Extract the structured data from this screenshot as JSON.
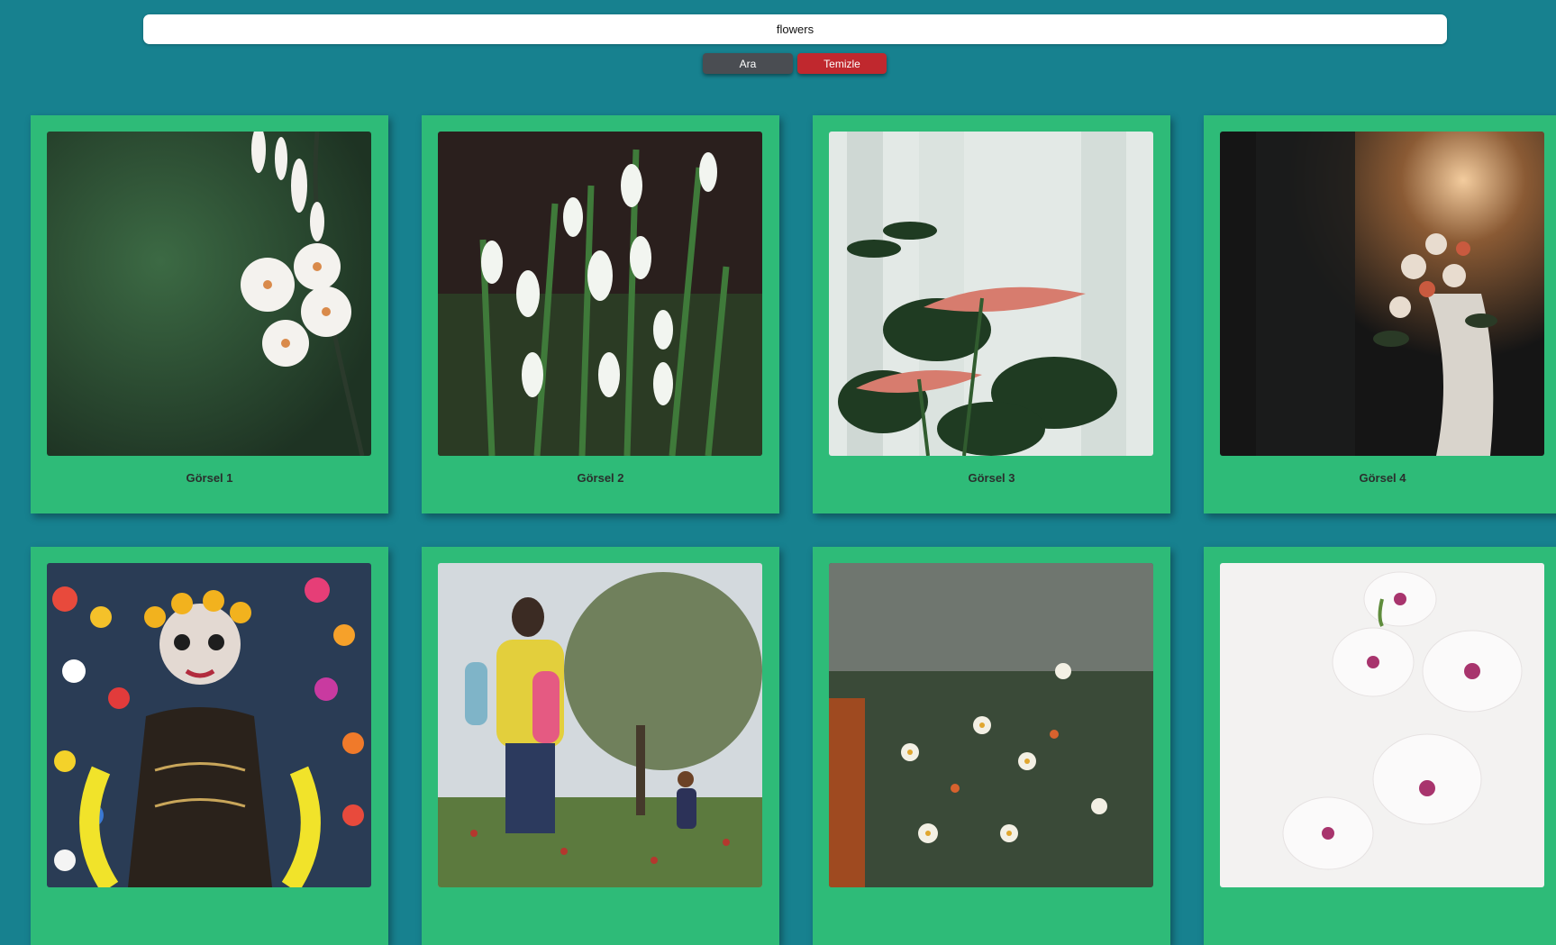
{
  "search": {
    "value": "flowers",
    "placeholder": ""
  },
  "buttons": {
    "search_label": "Ara",
    "clear_label": "Temizle"
  },
  "gallery": {
    "items": [
      {
        "caption": "Görsel 1",
        "image": "white-lily-flowers-photo"
      },
      {
        "caption": "Görsel 2",
        "image": "snowdrop-flowers-photo"
      },
      {
        "caption": "Görsel 3",
        "image": "anthurium-plant-photo"
      },
      {
        "caption": "Görsel 4",
        "image": "bridal-bouquet-photo"
      },
      {
        "caption": "",
        "image": "flower-crown-woman-photo"
      },
      {
        "caption": "",
        "image": "family-field-photo"
      },
      {
        "caption": "",
        "image": "daisy-meadow-photo"
      },
      {
        "caption": "",
        "image": "white-orchid-photo"
      }
    ]
  },
  "colors": {
    "background": "#17818f",
    "card": "#2ebb78",
    "search_button": "#4a4d52",
    "clear_button": "#c0282e"
  }
}
